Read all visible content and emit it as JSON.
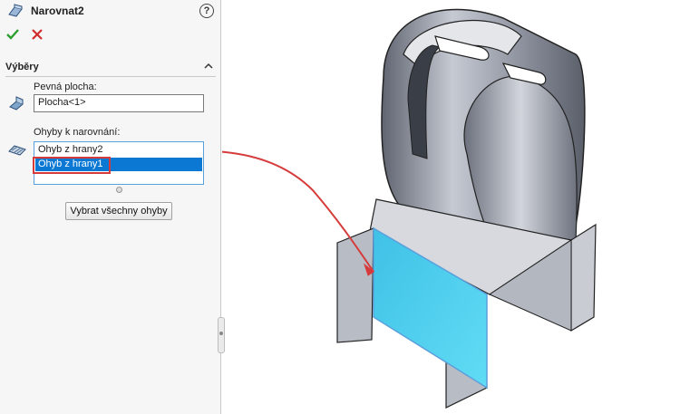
{
  "header": {
    "title": "Narovnat2",
    "help": "?"
  },
  "actions": {
    "ok_icon": "check-icon",
    "cancel_icon": "close-icon",
    "ok_color": "#2e9e2e",
    "cancel_color": "#d12b2b"
  },
  "section": {
    "title": "Výběry",
    "fixed_face_label": "Pevná plocha:",
    "fixed_face_value": "Plocha<1>",
    "bends_label": "Ohyby k narovnání:",
    "bends": [
      {
        "label": "Ohyb z hrany2",
        "selected": false
      },
      {
        "label": "Ohyb z hrany1",
        "selected": true
      }
    ],
    "select_all_button": "Vybrat všechny ohyby"
  },
  "colors": {
    "selection": "#0b78d4",
    "callout": "#d63b3b",
    "highlight_face": "#4fd3f0"
  }
}
